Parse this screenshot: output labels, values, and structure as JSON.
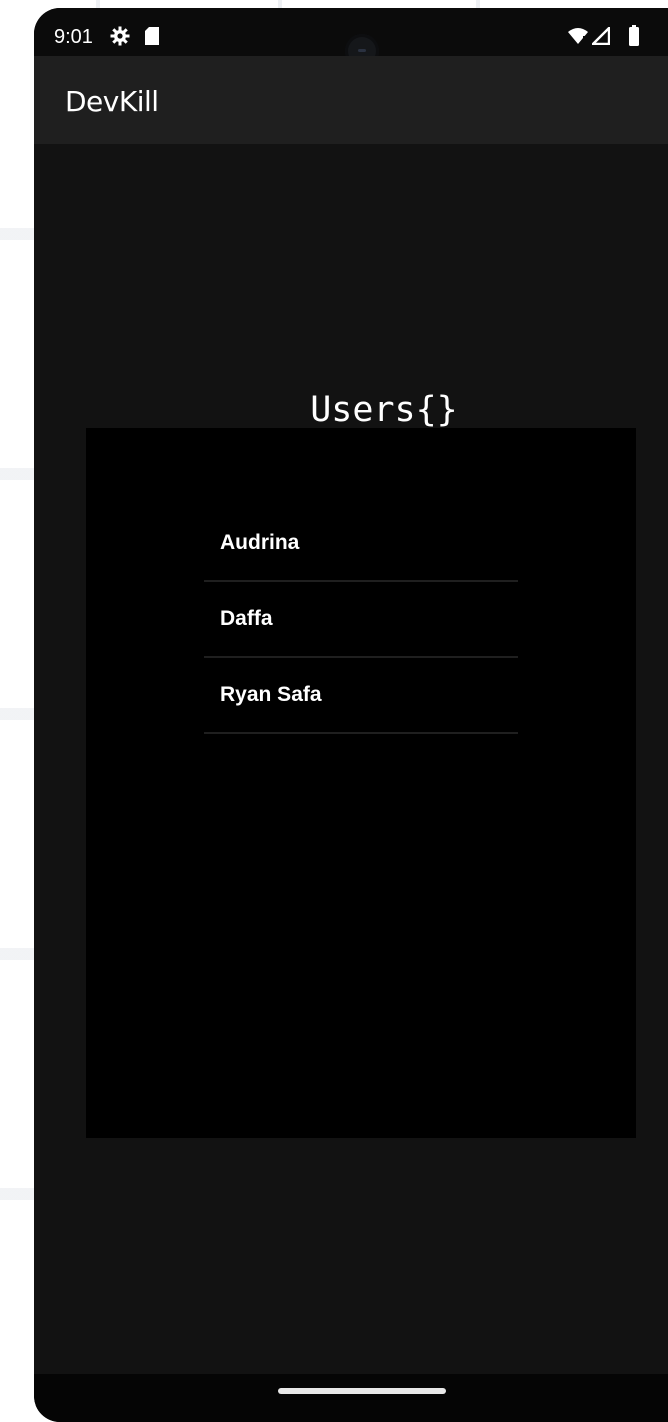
{
  "status_bar": {
    "time": "9:01",
    "icons": [
      "settings-gear-icon",
      "sd-card-icon",
      "wifi-icon",
      "cell-signal-icon",
      "battery-icon"
    ]
  },
  "app_bar": {
    "title": "DevKill"
  },
  "users_section": {
    "heading": "Users{}",
    "users": [
      {
        "name": "Audrina"
      },
      {
        "name": "Daffa"
      },
      {
        "name": "Ryan Safa"
      }
    ]
  },
  "colors": {
    "background": "#121212",
    "app_bar": "#1f1f1f",
    "panel": "#000000",
    "text": "#ffffff",
    "divider": "#1f1f1f"
  }
}
